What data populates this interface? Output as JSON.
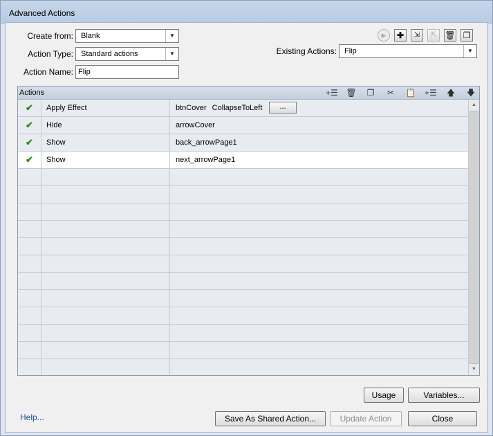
{
  "window": {
    "title": "Advanced Actions"
  },
  "form": {
    "create_from_label": "Create from:",
    "create_from_value": "Blank",
    "action_type_label": "Action Type:",
    "action_type_value": "Standard actions",
    "action_name_label": "Action Name:",
    "action_name_value": "Flip",
    "existing_actions_label": "Existing Actions:",
    "existing_actions_value": "Flip"
  },
  "toolbar_icons": [
    "preview-icon",
    "add-icon",
    "import-icon",
    "export-icon",
    "delete-icon",
    "duplicate-icon"
  ],
  "actions_grid": {
    "header": "Actions",
    "toolbar_icons": [
      "add-row-icon",
      "delete-row-icon",
      "copy-icon",
      "cut-icon",
      "paste-icon",
      "insert-icon",
      "move-up-icon",
      "move-down-icon"
    ],
    "rows": [
      {
        "checked": true,
        "action": "Apply Effect",
        "target": "btnCover",
        "target2": "CollapseToLeft",
        "has_more_button": true,
        "more_label": "..."
      },
      {
        "checked": true,
        "action": "Hide",
        "target": "arrowCover"
      },
      {
        "checked": true,
        "action": "Show",
        "target": "back_arrowPage1"
      },
      {
        "checked": true,
        "action": "Show",
        "target": "next_arrowPage1",
        "selected": true
      }
    ],
    "empty_row_count": 12
  },
  "buttons": {
    "usage": "Usage",
    "variables": "Variables...",
    "save_shared": "Save As Shared Action...",
    "update_action": "Update Action",
    "close": "Close",
    "help": "Help..."
  },
  "colors": {
    "check": "#2e8c1e",
    "link": "#1e4e9a",
    "selected_row": "#ffffff"
  }
}
